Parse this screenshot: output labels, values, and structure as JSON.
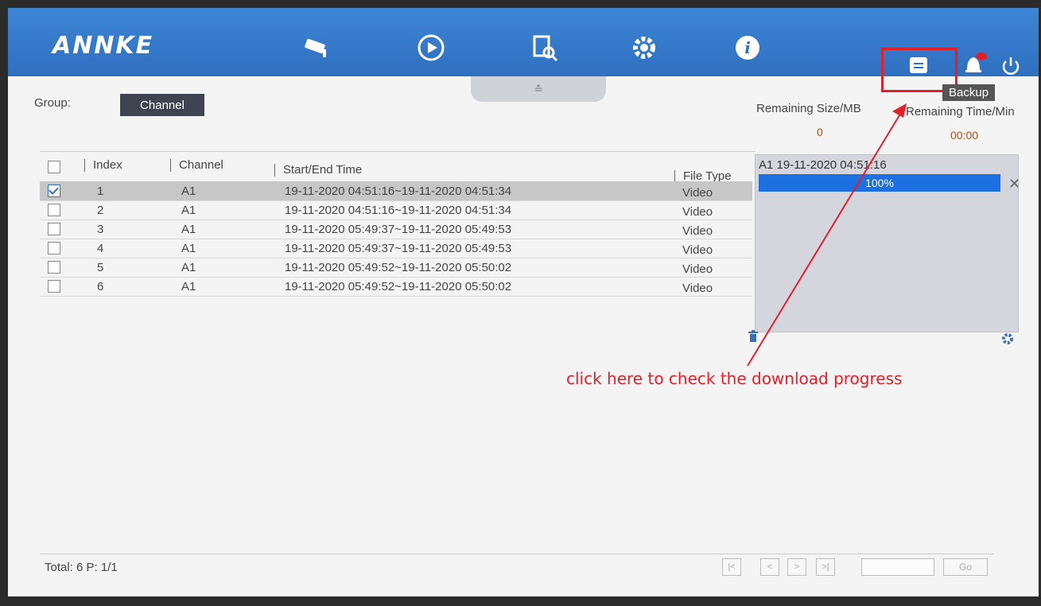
{
  "brand": {
    "logo": "ANNKE"
  },
  "nav": {
    "icons": [
      "camera-icon",
      "playback-icon",
      "search-file-icon",
      "settings-icon",
      "info-icon"
    ],
    "right_icons": [
      "backup-icon",
      "alarm-bell-icon",
      "power-icon"
    ]
  },
  "tooltip": "Backup",
  "group": {
    "label": "Group:",
    "button": "Channel"
  },
  "table": {
    "headers": {
      "index": "Index",
      "channel": "Channel",
      "time": "Start/End Time",
      "type": "File Type"
    },
    "rows": [
      {
        "index": "1",
        "channel": "A1",
        "time": "19-11-2020 04:51:16~19-11-2020 04:51:34",
        "type": "Video",
        "checked": true
      },
      {
        "index": "2",
        "channel": "A1",
        "time": "19-11-2020 04:51:16~19-11-2020 04:51:34",
        "type": "Video",
        "checked": false
      },
      {
        "index": "3",
        "channel": "A1",
        "time": "19-11-2020 05:49:37~19-11-2020 05:49:53",
        "type": "Video",
        "checked": false
      },
      {
        "index": "4",
        "channel": "A1",
        "time": "19-11-2020 05:49:37~19-11-2020 05:49:53",
        "type": "Video",
        "checked": false
      },
      {
        "index": "5",
        "channel": "A1",
        "time": "19-11-2020 05:49:52~19-11-2020 05:50:02",
        "type": "Video",
        "checked": false
      },
      {
        "index": "6",
        "channel": "A1",
        "time": "19-11-2020 05:49:52~19-11-2020 05:50:02",
        "type": "Video",
        "checked": false
      }
    ]
  },
  "backup_panel": {
    "remaining_size_label": "Remaining Size/MB",
    "remaining_time_label": "Remaining Time/Min",
    "remaining_size": "0",
    "remaining_time": "00:00",
    "task": {
      "title": "A1 19-11-2020 04:51:16",
      "progress": "100%"
    }
  },
  "annotation": "click here to check the download progress",
  "footer": {
    "total": "Total: 6 P: 1/1",
    "go": "Go"
  },
  "colors": {
    "topbar": "#3479cc",
    "highlight": "#e0202a",
    "progress": "#1e6fe0"
  }
}
